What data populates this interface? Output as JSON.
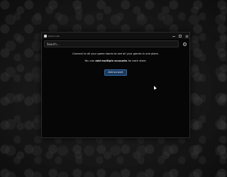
{
  "window": {
    "title": "Game hub"
  },
  "search": {
    "placeholder": "Search..."
  },
  "main": {
    "connect_message": "Connect to all your game stores to see all your games in one place.",
    "multi_prefix": "You can ",
    "multi_bold": "add multiple accounts",
    "multi_suffix": " for each store.",
    "add_account_label": "Add account"
  },
  "icons": {
    "app": "app-icon",
    "settings": "gear-icon",
    "minimize": "minimize-icon",
    "maximize": "maximize-icon",
    "close": "close-icon",
    "cursor": "mouse-cursor-icon"
  },
  "colors": {
    "accent": "#2f6aa7",
    "button_bg": "#1b3a5e",
    "window_bg": "#060606"
  }
}
